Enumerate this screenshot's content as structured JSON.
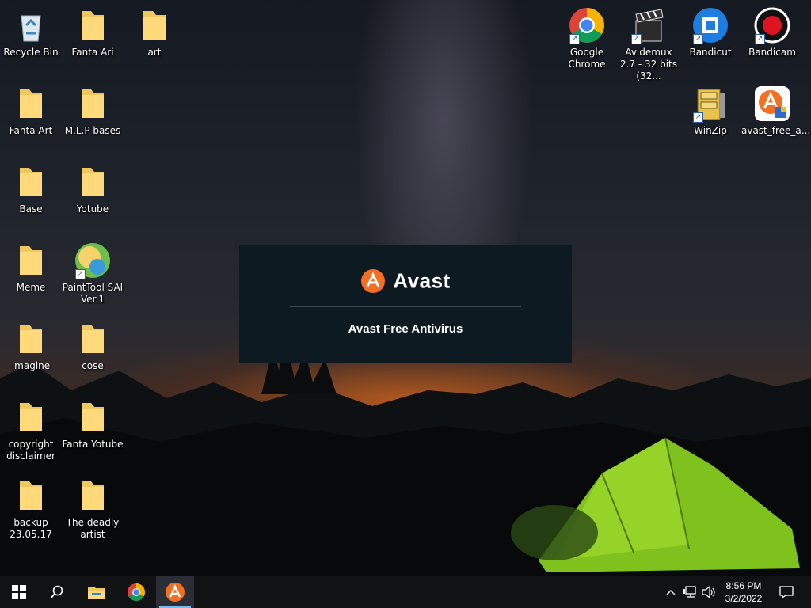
{
  "desktop": {
    "left_icons": [
      {
        "label": "Recycle Bin",
        "icon": "recycle-bin-icon"
      },
      {
        "label": "Fanta Ari",
        "icon": "folder-icon"
      },
      {
        "label": "art",
        "icon": "folder-icon"
      },
      {
        "label": "Fanta Art",
        "icon": "folder-icon"
      },
      {
        "label": "M.L.P bases",
        "icon": "folder-icon"
      },
      {
        "label": "Base",
        "icon": "folder-icon"
      },
      {
        "label": "Yotube",
        "icon": "folder-icon"
      },
      {
        "label": "Meme",
        "icon": "folder-icon"
      },
      {
        "label": "PaintTool SAI Ver.1",
        "icon": "painttool-sai-icon"
      },
      {
        "label": "imagine",
        "icon": "folder-icon"
      },
      {
        "label": "cose",
        "icon": "folder-icon"
      },
      {
        "label": "copyright disclaimer",
        "icon": "folder-icon"
      },
      {
        "label": "Fanta Yotube",
        "icon": "folder-icon"
      },
      {
        "label": "backup 23.05.17",
        "icon": "folder-icon"
      },
      {
        "label": "The deadly artist",
        "icon": "folder-icon"
      }
    ],
    "right_icons": [
      {
        "label": "Google Chrome",
        "icon": "chrome-icon"
      },
      {
        "label": "Avidemux 2.7 - 32 bits (32...",
        "icon": "avidemux-icon"
      },
      {
        "label": "Bandicut",
        "icon": "bandicut-icon"
      },
      {
        "label": "Bandicam",
        "icon": "bandicam-icon"
      },
      {
        "label": "WinZip",
        "icon": "winzip-icon"
      },
      {
        "label": "avast_free_a...",
        "icon": "avast-installer-icon"
      }
    ]
  },
  "splash": {
    "brand": "Avast",
    "product": "Avast Free Antivirus",
    "colors": {
      "background": "#0d1a22",
      "accent": "#f36f21"
    }
  },
  "taskbar": {
    "start": "windows-start-icon",
    "search": "search-icon",
    "pinned": [
      "file-explorer-icon",
      "chrome-icon",
      "avast-icon"
    ],
    "tray": [
      "chevron-up-icon",
      "network-icon",
      "volume-icon"
    ],
    "time": "8:56 PM",
    "date": "3/2/2022",
    "notification": "action-center-icon"
  }
}
